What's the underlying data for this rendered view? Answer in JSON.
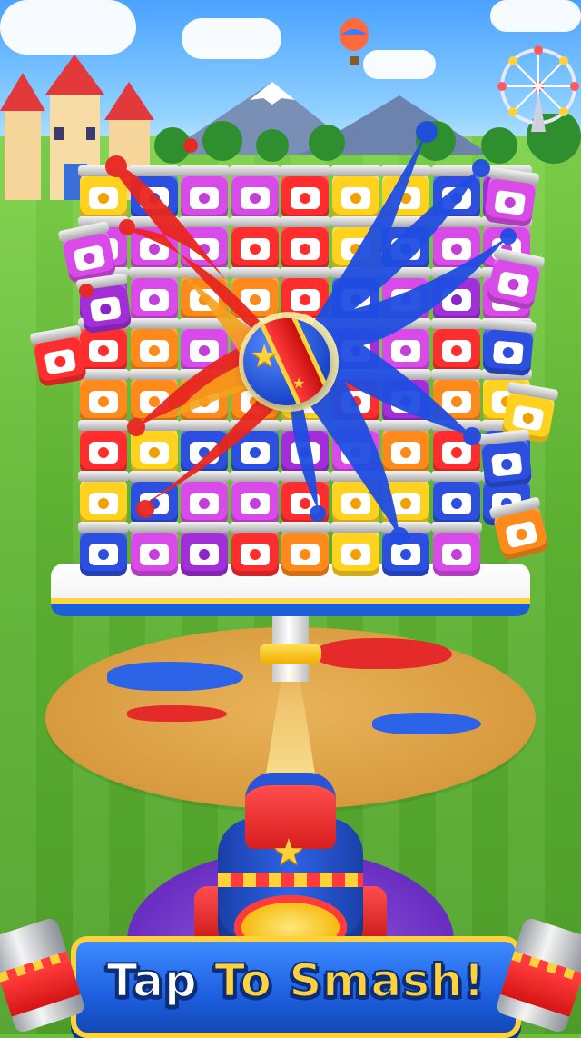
{
  "banner": {
    "word1": "Tap",
    "word2": "To",
    "word3": "Smash!"
  },
  "colors": {
    "red": "#ff2e2e",
    "orange": "#ff8a1c",
    "yellow": "#ffd21f",
    "blue": "#2d4fe0",
    "purple": "#a12ed8",
    "magenta": "#d84be8"
  },
  "icons": {
    "strawberry": "strawberry-icon",
    "orange": "orange-icon",
    "honey": "honey-dipper-icon",
    "blueberry": "blueberry-icon",
    "grape": "grape-icon",
    "plum": "plum-icon",
    "star": "star-icon"
  }
}
